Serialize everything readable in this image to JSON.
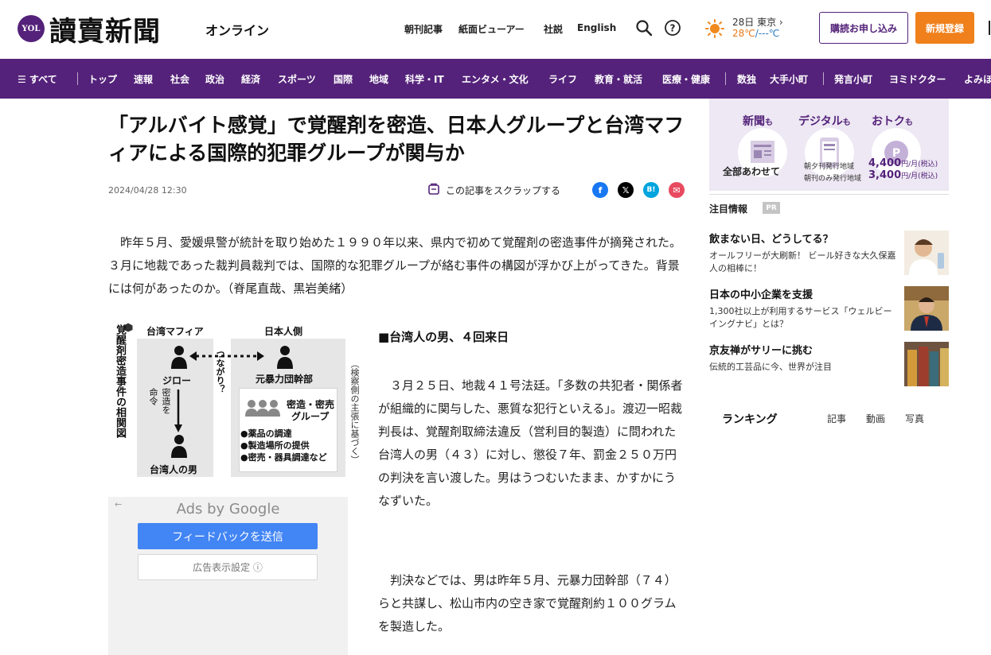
{
  "header": {
    "logo_mark": "YOL",
    "logo_text": "讀賣新聞",
    "logo_sub": "オンライン",
    "links": [
      "朝刊記事",
      "紙面ビューアー",
      "社説",
      "English"
    ],
    "weather": {
      "date_city": "28日 東京",
      "high": "28℃",
      "low": "/---℃"
    },
    "subscribe_label": "購読お申し込み",
    "register_label": "新規登録"
  },
  "nav": {
    "all_label": "☰ すべて",
    "items": [
      "トップ",
      "速報",
      "社会",
      "政治",
      "経済",
      "スポーツ",
      "国際",
      "地域",
      "科学・IT",
      "エンタメ・文化",
      "ライフ",
      "教育・就活",
      "医療・健康",
      "数独",
      "大手小町",
      "発言小町",
      "ヨミドクター",
      "よみほ"
    ]
  },
  "article": {
    "title": "「アルバイト感覚」で覚醒剤を密造、日本人グループと台湾マフィアによる国際的犯罪グループが関与か",
    "date": "2024/04/28 12:30",
    "scrap_label": "この記事をスクラップする",
    "lead": "昨年５月、愛媛県警が統計を取り始めた１９９０年以来、県内で初めて覚醒剤の密造事件が摘発された。３月に地裁であった裁判員裁判では、国際的な犯罪グループが絡む事件の構図が浮かび上がってきた。背景には何があったのか。（脊尾直哉、黒岩美緒）",
    "subheading": "■台湾人の男、４回来日",
    "para1": "３月２５日、地裁４１号法廷。「多数の共犯者・関係者が組織的に関与した、悪質な犯行といえる」。渡辺一昭裁判長は、覚醒剤取締法違反（営利目的製造）に問われた台湾人の男（４３）に対し、懲役７年、罰金２５０万円の判決を言い渡した。男はうつむいたまま、かすかにうなずいた。",
    "para2": "判決などでは、男は昨年５月、元暴力団幹部（７４）らと共謀し、松山市内の空き家で覚醒剤約１００グラムを製造した。"
  },
  "diagram": {
    "title": "覚醒剤密造事件の相関図",
    "left_header": "台湾マフィア",
    "right_header": "日本人側",
    "jiro": "ジロー",
    "command": "命令",
    "manufacture": "密造を",
    "taiwan_man": "台湾人の男",
    "connection": "つながり？",
    "former_yakuza": "元暴力団幹部",
    "group": [
      "密造・密売",
      "グループ"
    ],
    "roles": [
      "●薬品の調達",
      "●製造場所の提供",
      "●密売・器具調達など"
    ],
    "note": "（検察側の主張に基づく）"
  },
  "ad": {
    "title": "Ads by Google",
    "feedback_label": "フィードバックを送信",
    "settings_label": "広告表示設定 ⓘ"
  },
  "promo": {
    "c1": "新聞",
    "c2": "デジタル",
    "c3": "おトク",
    "suffix": "も",
    "all": "全部あわせて",
    "plan1": "朝夕刊発行地域",
    "price1": "4,400",
    "plan2": "朝刊のみ発行地域",
    "price2": "3,400",
    "unit": "円/月(税込)"
  },
  "sidebar": {
    "notice_label": "注目情報",
    "pr_label": "PR",
    "items": [
      {
        "title": "飲まない日、どうしてる？",
        "desc": "オールフリーが大刷新！ ビール好きな大久保嘉人の相棒に！"
      },
      {
        "title": "日本の中小企業を支援",
        "desc": "1,300社以上が利用するサービス「ウェルビーイングナビ」とは？"
      },
      {
        "title": "京友禅がサリーに挑む",
        "desc": "伝統的工芸品に今、世界が注目"
      }
    ],
    "ranking_label": "ランキング",
    "ranking_tabs": [
      "記事",
      "動画",
      "写真"
    ]
  },
  "colors": {
    "brand_purple": "#54227a",
    "register_orange": "#f0801b",
    "ad_blue": "#4285f4"
  }
}
